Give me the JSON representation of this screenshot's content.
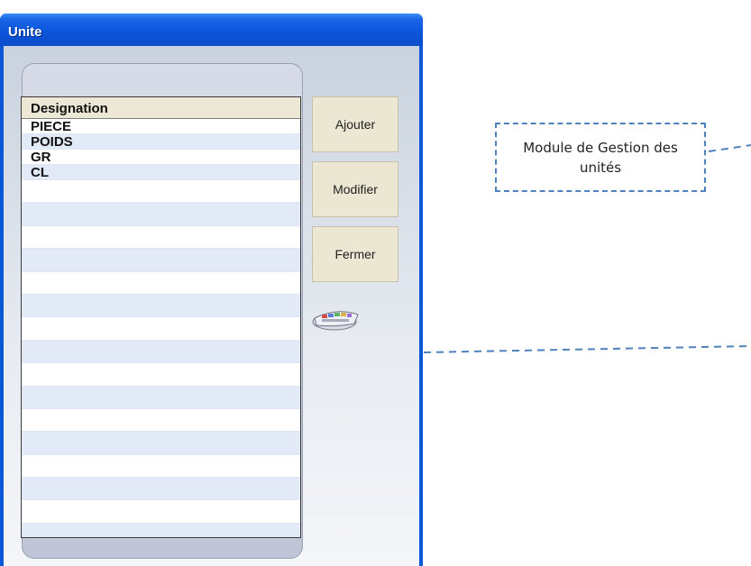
{
  "window": {
    "title": "Unite"
  },
  "grid": {
    "header": "Designation",
    "rows": [
      "PIECE",
      "POIDS",
      "GR",
      "CL"
    ]
  },
  "buttons": {
    "add": "Ajouter",
    "edit": "Modifier",
    "close": "Fermer"
  },
  "icons": {
    "keyboard": "keyboard-icon"
  },
  "callout": {
    "text": "Module de Gestion des unités"
  },
  "colors": {
    "titlebar": "#0b55db",
    "header": "#ede7d5",
    "row_alt": "#e2eaf8",
    "button": "#ece7d3",
    "callout_border": "#4f81bd"
  }
}
